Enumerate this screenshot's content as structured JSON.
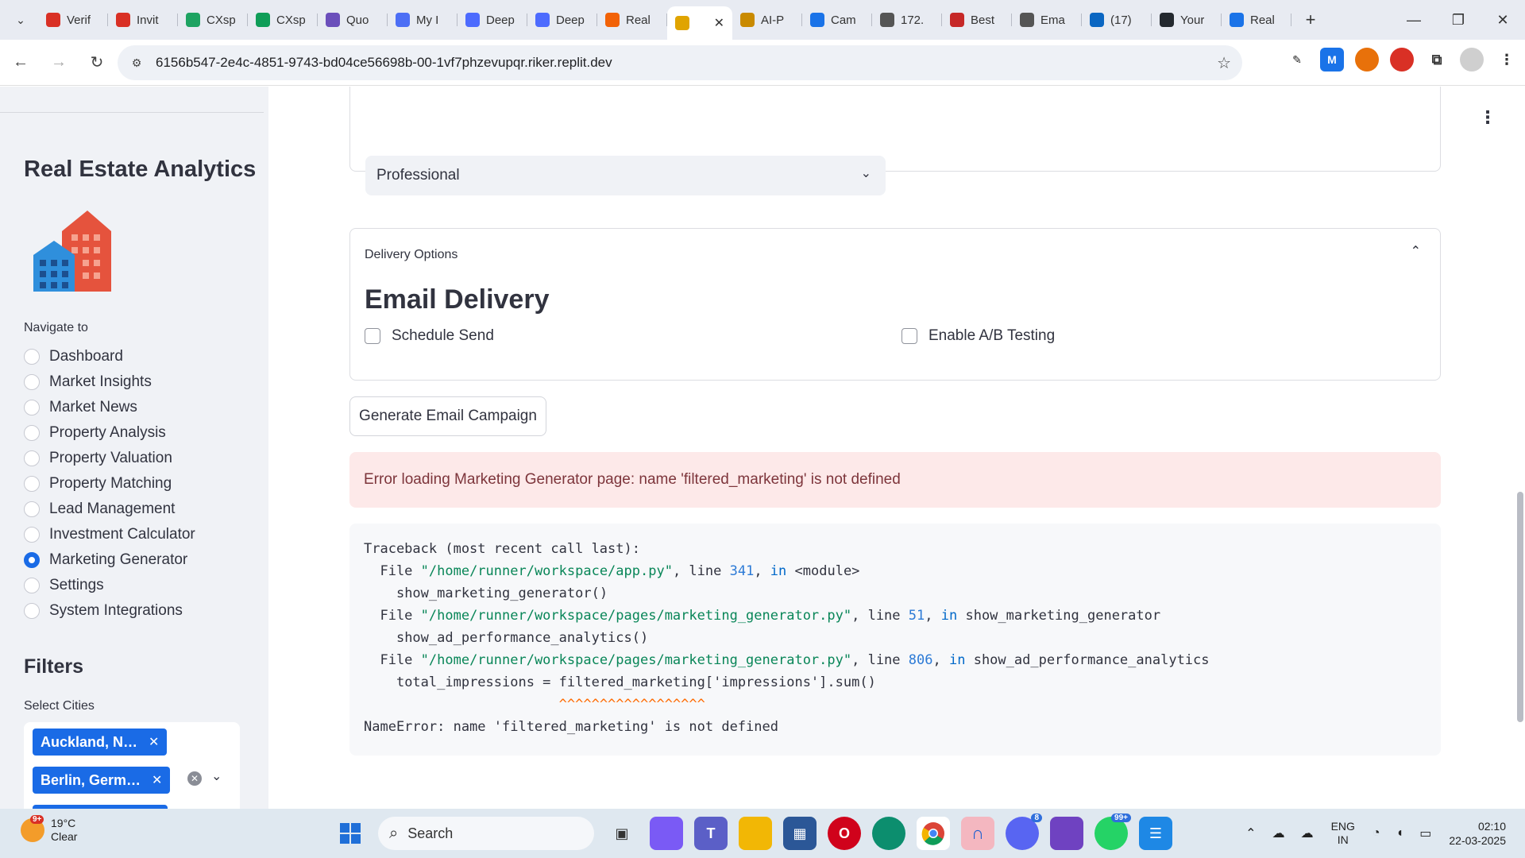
{
  "browser": {
    "tabs": [
      {
        "label": "Verif",
        "favicon_color": "#d93025",
        "icon": "gmail-icon"
      },
      {
        "label": "Invit",
        "favicon_color": "#d93025",
        "icon": "gmail-icon"
      },
      {
        "label": "CXsp",
        "favicon_color": "#1ea362",
        "icon": "drive-icon"
      },
      {
        "label": "CXsp",
        "favicon_color": "#0f9d58",
        "icon": "sheets-icon"
      },
      {
        "label": "Quo",
        "favicon_color": "#6b4fbb",
        "icon": "app-icon"
      },
      {
        "label": "My I",
        "favicon_color": "#4c6ef5",
        "icon": "app-icon"
      },
      {
        "label": "Deep",
        "favicon_color": "#4d6bfe",
        "icon": "deepseek-icon"
      },
      {
        "label": "Deep",
        "favicon_color": "#4d6bfe",
        "icon": "deepseek-icon"
      },
      {
        "label": "Real",
        "favicon_color": "#f26207",
        "icon": "replit-icon"
      },
      {
        "label": "",
        "favicon_color": "#e0a400",
        "icon": "house-icon",
        "active": true
      },
      {
        "label": "AI-P",
        "favicon_color": "#c98a00",
        "icon": "house-icon"
      },
      {
        "label": "Cam",
        "favicon_color": "#1a73e8",
        "icon": "app-icon"
      },
      {
        "label": "172.",
        "favicon_color": "#555555",
        "icon": "globe-icon"
      },
      {
        "label": "Best",
        "favicon_color": "#c62828",
        "icon": "app-icon"
      },
      {
        "label": "Ema",
        "favicon_color": "#555555",
        "icon": "app-icon"
      },
      {
        "label": "(17)",
        "favicon_color": "#0a66c2",
        "icon": "linkedin-icon"
      },
      {
        "label": "Your",
        "favicon_color": "#24292f",
        "icon": "github-icon"
      },
      {
        "label": "Real",
        "favicon_color": "#1a73e8",
        "icon": "app-icon"
      }
    ],
    "url": "6156b547-2e4c-4851-9743-bd04ce56698b-00-1vf7phzevupqr.riker.replit.dev"
  },
  "sidebar": {
    "title": "Real Estate Analytics",
    "nav_label": "Navigate to",
    "nav_items": [
      {
        "label": "Dashboard",
        "selected": false
      },
      {
        "label": "Market Insights",
        "selected": false
      },
      {
        "label": "Market News",
        "selected": false
      },
      {
        "label": "Property Analysis",
        "selected": false
      },
      {
        "label": "Property Valuation",
        "selected": false
      },
      {
        "label": "Property Matching",
        "selected": false
      },
      {
        "label": "Lead Management",
        "selected": false
      },
      {
        "label": "Investment Calculator",
        "selected": false
      },
      {
        "label": "Marketing Generator",
        "selected": true
      },
      {
        "label": "Settings",
        "selected": false
      },
      {
        "label": "System Integrations",
        "selected": false
      }
    ],
    "filters_title": "Filters",
    "cities_label": "Select Cities",
    "cities": [
      "Auckland, N…",
      "Berlin, Germ…"
    ]
  },
  "main": {
    "tone_select_value": "Professional",
    "delivery": {
      "header": "Delivery Options",
      "title": "Email Delivery",
      "schedule_label": "Schedule Send",
      "ab_label": "Enable A/B Testing"
    },
    "generate_button": "Generate Email Campaign",
    "error_message": "Error loading Marketing Generator page: name 'filtered_marketing' is not defined",
    "traceback": {
      "header": "Traceback (most recent call last):",
      "frames": [
        {
          "file": "\"/home/runner/workspace/app.py\"",
          "line": "341",
          "func": "<module>",
          "code": "show_marketing_generator()"
        },
        {
          "file": "\"/home/runner/workspace/pages/marketing_generator.py\"",
          "line": "51",
          "func": "show_marketing_generator",
          "code": "show_ad_performance_analytics()"
        },
        {
          "file": "\"/home/runner/workspace/pages/marketing_generator.py\"",
          "line": "806",
          "func": "show_ad_performance_analytics",
          "code": "total_impressions = filtered_marketing['impressions'].sum()"
        }
      ],
      "carets": "^^^^^^^^^^^^^^^^^^",
      "error_line": "NameError: name 'filtered_marketing' is not defined"
    }
  },
  "taskbar": {
    "weather_temp": "19°C",
    "weather_desc": "Clear",
    "weather_badge": "9+",
    "search_label": "Search",
    "discord_badge": "8",
    "whatsapp_badge": "99+",
    "lang_line1": "ENG",
    "lang_line2": "IN",
    "time": "02:10",
    "date": "22-03-2025"
  }
}
